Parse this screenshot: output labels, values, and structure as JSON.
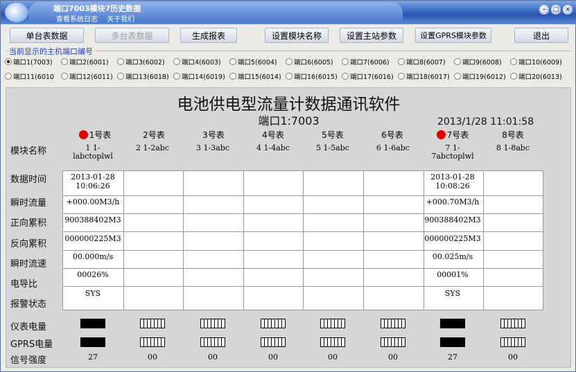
{
  "window": {
    "title": "端口7003模块7历史数据",
    "menu": [
      "查看系统日志",
      "关于我们"
    ]
  },
  "toolbar": [
    {
      "label": "单台表数据",
      "disabled": false
    },
    {
      "label": "多台表数据",
      "disabled": true
    },
    {
      "label": "生成报表",
      "disabled": false
    },
    {
      "label": "设置模块名称",
      "disabled": false
    },
    {
      "label": "设置主站参数",
      "disabled": false
    },
    {
      "label": "设置GPRS模块参数",
      "disabled": false
    },
    {
      "label": "退出",
      "disabled": false
    }
  ],
  "port_group_label": "当前显示的主机端口编号",
  "ports": [
    {
      "label": "端口1(7003)",
      "selected": true
    },
    {
      "label": "端口2(6001)",
      "selected": false
    },
    {
      "label": "端口3(6002)",
      "selected": false
    },
    {
      "label": "端口4(6003)",
      "selected": false
    },
    {
      "label": "端口5(6004)",
      "selected": false
    },
    {
      "label": "端口6(6005)",
      "selected": false
    },
    {
      "label": "端口7(6006)",
      "selected": false
    },
    {
      "label": "端口8(6007)",
      "selected": false
    },
    {
      "label": "端口9(6008)",
      "selected": false
    },
    {
      "label": "端口10(6009)",
      "selected": false
    },
    {
      "label": "端口11(6010",
      "selected": false
    },
    {
      "label": "端口12(6011)",
      "selected": false
    },
    {
      "label": "端口13(6018)",
      "selected": false
    },
    {
      "label": "端口14(6019)",
      "selected": false
    },
    {
      "label": "端口15(6014)",
      "selected": false
    },
    {
      "label": "端口16(6015)",
      "selected": false
    },
    {
      "label": "端口17(6016)",
      "selected": false
    },
    {
      "label": "端口18(6017)",
      "selected": false
    },
    {
      "label": "端口19(6012)",
      "selected": false
    },
    {
      "label": "端口20(6013)",
      "selected": false
    }
  ],
  "main": {
    "app_title": "电池供电型流量计数据通讯软件",
    "port_title": "端口1:7003",
    "datetime": "2013/1/28  11:01:58"
  },
  "row_labels": {
    "module_name": "模块名称",
    "data_time": "数据时间",
    "instant_flow": "瞬时流量",
    "forward_total": "正向累积",
    "reverse_total": "反向累积",
    "instant_speed": "瞬时流速",
    "conductivity": "电导比",
    "alarm": "报警状态",
    "meter_power": "仪表电量",
    "gprs_power": "GPRS电量",
    "signal": "信号强度"
  },
  "meters": [
    {
      "header": "1号表",
      "active": true,
      "name": "1 1-\nlabctoplwl",
      "data_time": "2013-01-28\n10:06:26",
      "instant_flow": "+000.00M3/h",
      "forward_total": "900388402M3",
      "reverse_total": "000000225M3",
      "instant_speed": "00.000m/s",
      "conductivity": "00026%",
      "alarm": "SYS",
      "meter_power_full": true,
      "gprs_power_full": true,
      "signal": "27"
    },
    {
      "header": "2号表",
      "active": false,
      "name": "2 1-2abc",
      "data_time": "",
      "instant_flow": "",
      "forward_total": "",
      "reverse_total": "",
      "instant_speed": "",
      "conductivity": "",
      "alarm": "",
      "meter_power_full": false,
      "gprs_power_full": false,
      "signal": "00"
    },
    {
      "header": "3号表",
      "active": false,
      "name": "3 1-3abc",
      "data_time": "",
      "instant_flow": "",
      "forward_total": "",
      "reverse_total": "",
      "instant_speed": "",
      "conductivity": "",
      "alarm": "",
      "meter_power_full": false,
      "gprs_power_full": false,
      "signal": "00"
    },
    {
      "header": "4号表",
      "active": false,
      "name": "4 1-4abc",
      "data_time": "",
      "instant_flow": "",
      "forward_total": "",
      "reverse_total": "",
      "instant_speed": "",
      "conductivity": "",
      "alarm": "",
      "meter_power_full": false,
      "gprs_power_full": false,
      "signal": "00"
    },
    {
      "header": "5号表",
      "active": false,
      "name": "5 1-5abc",
      "data_time": "",
      "instant_flow": "",
      "forward_total": "",
      "reverse_total": "",
      "instant_speed": "",
      "conductivity": "",
      "alarm": "",
      "meter_power_full": false,
      "gprs_power_full": false,
      "signal": "00"
    },
    {
      "header": "6号表",
      "active": false,
      "name": "6 1-6abc",
      "data_time": "",
      "instant_flow": "",
      "forward_total": "",
      "reverse_total": "",
      "instant_speed": "",
      "conductivity": "",
      "alarm": "",
      "meter_power_full": false,
      "gprs_power_full": false,
      "signal": "00"
    },
    {
      "header": "7号表",
      "active": true,
      "name": "7 1-\n7abctoplwl",
      "data_time": "2013-01-28\n10:08:26",
      "instant_flow": "+000.70M3/h",
      "forward_total": "900388402M3",
      "reverse_total": "000000225M3",
      "instant_speed": "00.025m/s",
      "conductivity": "00001%",
      "alarm": "SYS",
      "meter_power_full": true,
      "gprs_power_full": true,
      "signal": "27"
    },
    {
      "header": "8号表",
      "active": false,
      "name": "8 1-8abc",
      "data_time": "",
      "instant_flow": "",
      "forward_total": "",
      "reverse_total": "",
      "instant_speed": "",
      "conductivity": "",
      "alarm": "",
      "meter_power_full": false,
      "gprs_power_full": false,
      "signal": "00"
    }
  ]
}
